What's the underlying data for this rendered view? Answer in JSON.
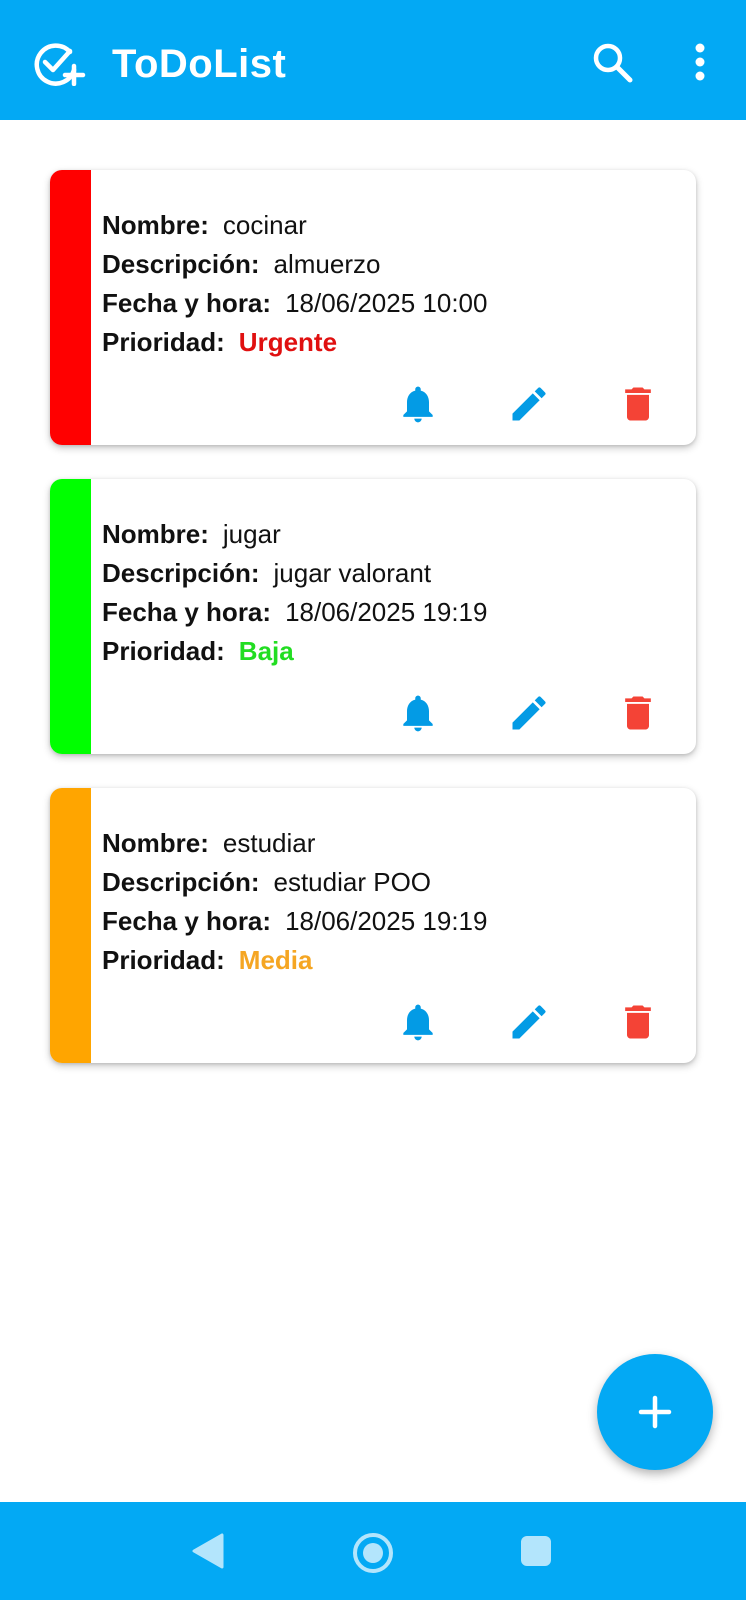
{
  "appbar": {
    "title": "ToDoList",
    "icons": {
      "app": "check-circle-plus-icon",
      "search": "search-icon",
      "more": "more-vert-icon"
    }
  },
  "labels": {
    "nombre": "Nombre:",
    "descripcion": "Descripción:",
    "fecha": "Fecha y hora:",
    "prioridad": "Prioridad:"
  },
  "tasks": [
    {
      "nombre": "cocinar",
      "descripcion": "almuerzo",
      "fecha": "18/06/2025 10:00",
      "prioridad": "Urgente",
      "color": "#FF0000",
      "text_color": "#E01010"
    },
    {
      "nombre": "jugar",
      "descripcion": "jugar valorant",
      "fecha": "18/06/2025 19:19",
      "prioridad": "Baja",
      "color": "#00FF00",
      "text_color": "#22DD22"
    },
    {
      "nombre": "estudiar",
      "descripcion": "estudiar POO",
      "fecha": "18/06/2025 19:19",
      "prioridad": "Media",
      "color": "#FFA500",
      "text_color": "#F5A623"
    }
  ],
  "actions": {
    "notify": "bell-icon",
    "edit": "pencil-icon",
    "delete": "trash-icon"
  },
  "fab": {
    "icon": "plus-icon"
  },
  "navbar": {
    "icons": [
      "back-icon",
      "home-icon",
      "recents-icon"
    ]
  },
  "colors": {
    "primary": "#03A9F4",
    "action_blue": "#039BE5",
    "delete_red": "#F44336"
  }
}
